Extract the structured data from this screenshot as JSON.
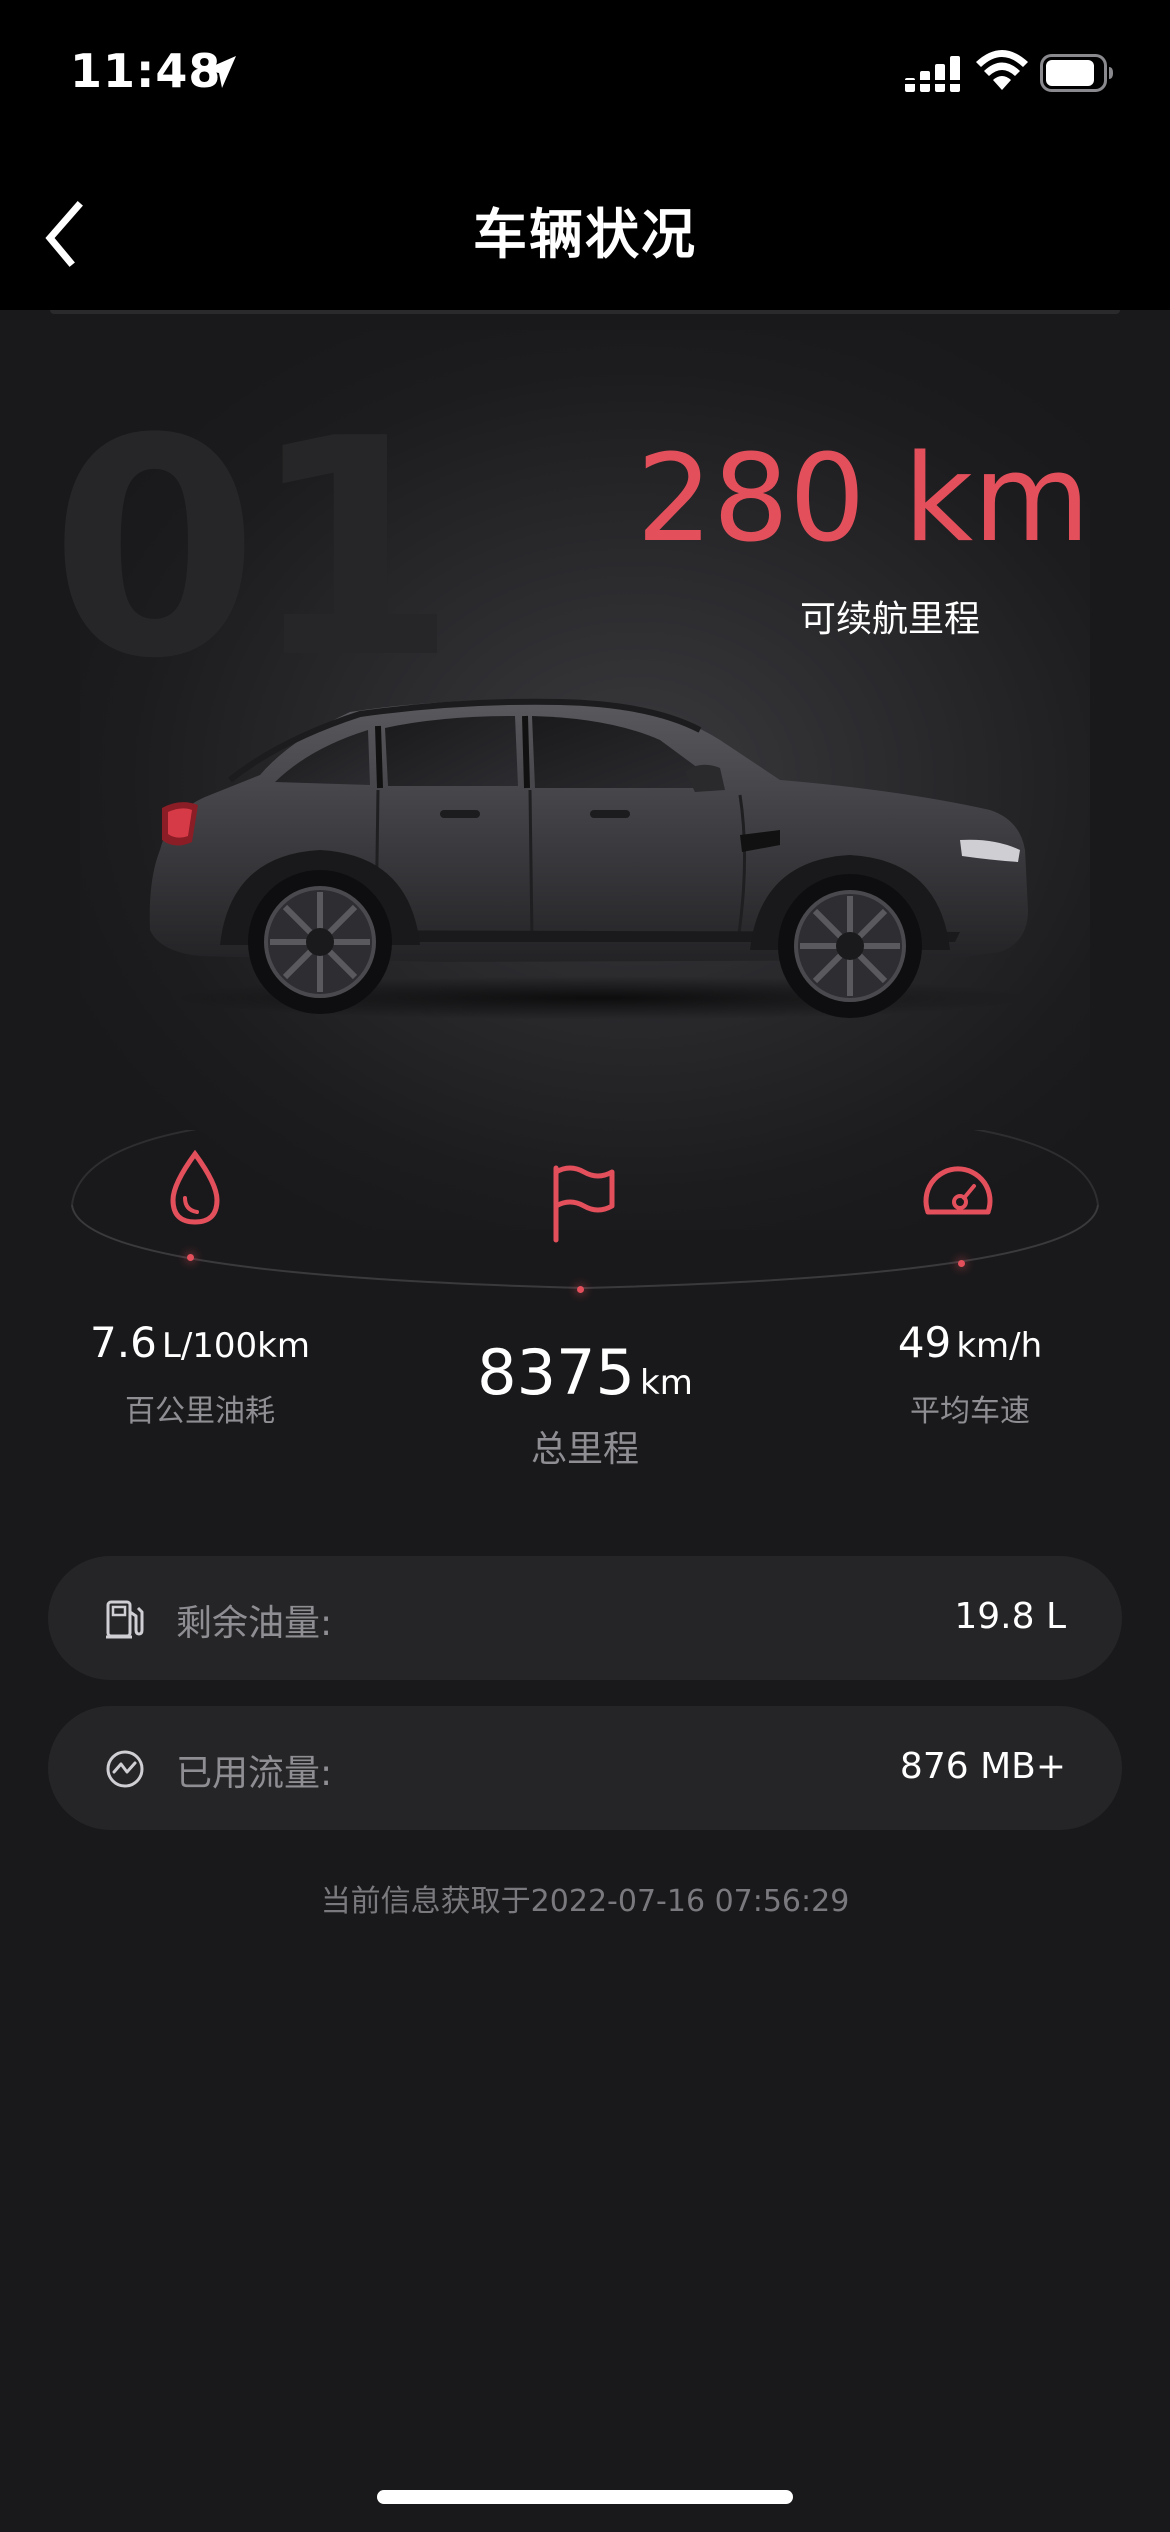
{
  "status_bar": {
    "time": "11:48"
  },
  "nav": {
    "title": "车辆状况"
  },
  "hero": {
    "background_number": "01",
    "range_value": "280 km",
    "range_label": "可续航里程"
  },
  "stats": {
    "fuel_consumption": {
      "value": "7.6",
      "unit": "L/100km",
      "label": "百公里油耗"
    },
    "total_mileage": {
      "value": "8375",
      "unit": "km",
      "label": "总里程"
    },
    "average_speed": {
      "value": "49",
      "unit": "km/h",
      "label": "平均车速"
    }
  },
  "info": {
    "fuel_remaining": {
      "label": "剩余油量:",
      "value": "19.8 L"
    },
    "data_used": {
      "label": "已用流量:",
      "value": "876 MB+"
    }
  },
  "update_time": "当前信息获取于2022-07-16 07:56:29",
  "colors": {
    "accent": "#e3505c",
    "background": "#19191b",
    "card": "#252527",
    "muted_text": "#8e8e93"
  }
}
